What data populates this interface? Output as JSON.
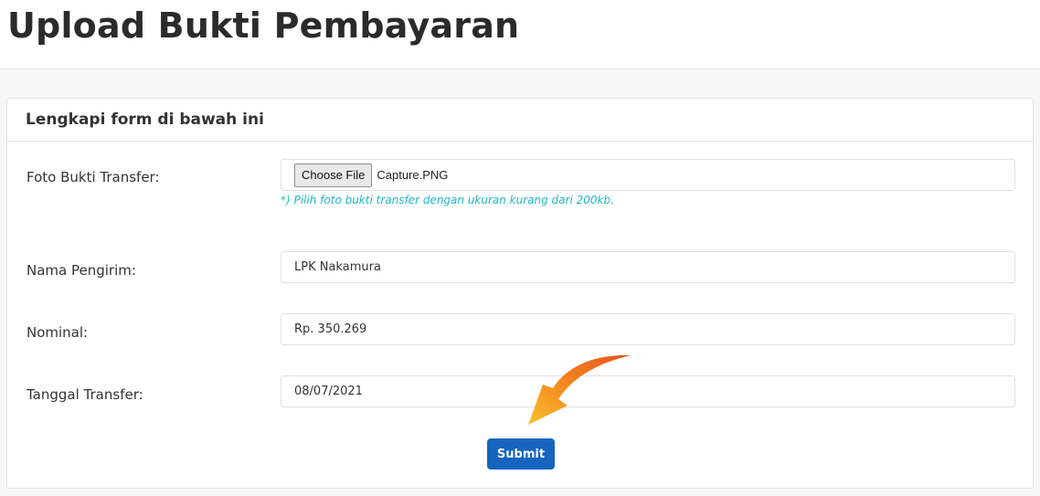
{
  "page": {
    "title": "Upload Bukti Pembayaran"
  },
  "card": {
    "title": "Lengkapi form di bawah ini"
  },
  "form": {
    "foto": {
      "label": "Foto Bukti Transfer:",
      "button_label": "Choose File",
      "file_name": "Capture.PNG",
      "hint": "*) Pilih foto bukti transfer dengan ukuran kurang dari 200kb."
    },
    "nama": {
      "label": "Nama Pengirim:",
      "value": "LPK Nakamura"
    },
    "nominal": {
      "label": "Nominal:",
      "value": "Rp. 350.269"
    },
    "tanggal": {
      "label": "Tanggal Transfer:",
      "value": "08/07/2021"
    },
    "submit_label": "Submit"
  },
  "colors": {
    "accent": "#1565c0",
    "hint": "#1fb6c4",
    "arrow": "#f28a1e"
  },
  "icons": {
    "pointer": "curved-arrow-icon"
  }
}
